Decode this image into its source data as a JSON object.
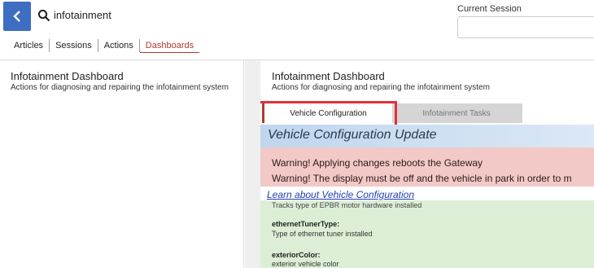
{
  "header": {
    "search_value": "infotainment",
    "session_label": "Current Session"
  },
  "nav_tabs": {
    "articles": "Articles",
    "sessions": "Sessions",
    "actions": "Actions",
    "dashboards": "Dashboards"
  },
  "left": {
    "title": "Infotainment Dashboard",
    "description": "Actions for diagnosing and repairing the infotainment system"
  },
  "right": {
    "title": "Infotainment Dashboard",
    "description": "Actions for diagnosing and repairing the infotainment system",
    "subtabs": {
      "config": "Vehicle Configuration",
      "tasks": "Infotainment Tasks"
    },
    "section_title": "Vehicle Configuration Update",
    "warnings": [
      "Warning! Applying changes reboots the Gateway",
      "Warning! The display must be off and the vehicle in park in order to m"
    ],
    "learn_link": "Learn about Vehicle Configuration",
    "fields_partial": "Tracks type of EPBR motor hardware installed",
    "fields": [
      {
        "name": "ethernetTunerType:",
        "desc": "Type of ethernet tuner installed"
      },
      {
        "name": "exteriorColor:",
        "desc": "exterior vehicle color"
      }
    ]
  },
  "colors": {
    "accent": "#3d6ec2",
    "active_tab": "#b23a2e",
    "warning_bg": "#f2c9c6",
    "highlight": "#e0313b"
  }
}
